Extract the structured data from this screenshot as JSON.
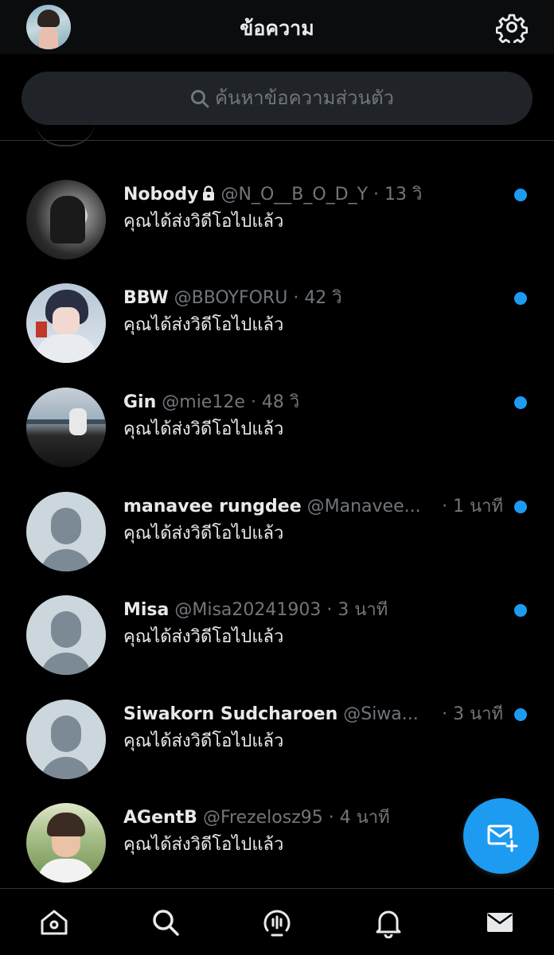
{
  "header": {
    "title": "ข้อความ"
  },
  "search": {
    "placeholder": "ค้นหาข้อความส่วนตัว"
  },
  "conversations": [
    {
      "name": "Nobody",
      "handle": "@N_O__B_O_D_Y",
      "time": "· 13 วิ",
      "message": "คุณได้ส่งวิดีโอไปแล้ว",
      "unread": true,
      "locked": true
    },
    {
      "name": "BBW",
      "handle": "@BBOYFORU",
      "time": "· 42 วิ",
      "message": "คุณได้ส่งวิดีโอไปแล้ว",
      "unread": true
    },
    {
      "name": "Gin",
      "handle": "@mie12e",
      "time": "· 48 วิ",
      "message": "คุณได้ส่งวิดีโอไปแล้ว",
      "unread": true
    },
    {
      "name": "manavee rungdee",
      "handle": "@Manavee...",
      "time": "· 1 นาที",
      "message": "คุณได้ส่งวิดีโอไปแล้ว",
      "unread": true
    },
    {
      "name": "Misa",
      "handle": "@Misa20241903",
      "time": "· 3 นาที",
      "message": "คุณได้ส่งวิดีโอไปแล้ว",
      "unread": true
    },
    {
      "name": "Siwakorn Sudcharoen",
      "handle": "@Siwa...",
      "time": "· 3 นาที",
      "message": "คุณได้ส่งวิดีโอไปแล้ว",
      "unread": true
    },
    {
      "name": "AGentB",
      "handle": "@Frezelosz95",
      "time": "· 4 นาที",
      "message": "คุณได้ส่งวิดีโอไปแล้ว",
      "unread": false
    }
  ],
  "icons": {
    "settings": "gear-icon",
    "search": "search-icon",
    "compose": "new-message-icon",
    "nav": [
      "home-icon",
      "search-icon",
      "spaces-icon",
      "bell-icon",
      "mail-icon"
    ]
  },
  "colors": {
    "accent": "#1d9bf0",
    "background": "#000000",
    "muted_text": "#71767b"
  }
}
